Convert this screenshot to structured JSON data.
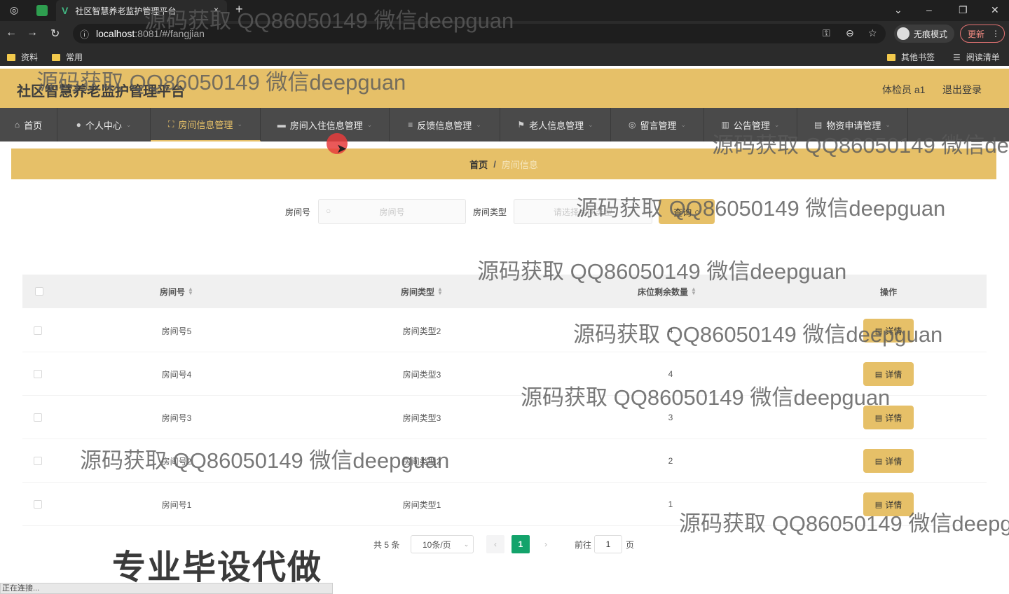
{
  "browser": {
    "tab_title": "社区智慧养老监护管理平台",
    "tab_close": "×",
    "new_tab": "+",
    "url_host": "localhost",
    "url_path": ":8081/#/fangjian",
    "incognito_label": "无痕模式",
    "update_label": "更新",
    "bookmarks": [
      "资料",
      "常用"
    ],
    "other_bookmarks": "其他书签",
    "reading_list": "阅读清单"
  },
  "header": {
    "title": "社区智慧养老监护管理平台",
    "user_role": "体检员 a1",
    "logout": "退出登录"
  },
  "menu": {
    "items": [
      {
        "label": "首页",
        "icon": "home-icon"
      },
      {
        "label": "个人中心",
        "icon": "user-icon"
      },
      {
        "label": "房间信息管理",
        "icon": "fullscreen-icon",
        "active": true
      },
      {
        "label": "房间入住信息管理",
        "icon": "monitor-icon"
      },
      {
        "label": "反馈信息管理",
        "icon": "list-icon"
      },
      {
        "label": "老人信息管理",
        "icon": "flag-icon"
      },
      {
        "label": "留言管理",
        "icon": "compass-icon"
      },
      {
        "label": "公告管理",
        "icon": "chart-icon"
      },
      {
        "label": "物资申请管理",
        "icon": "document-icon"
      }
    ]
  },
  "breadcrumb": {
    "home": "首页",
    "separator": "/",
    "current": "房间信息"
  },
  "search": {
    "room_no_label": "房间号",
    "room_no_placeholder": "房间号",
    "room_type_label": "房间类型",
    "room_type_placeholder": "请选择房间类型",
    "query_button": "查询"
  },
  "table": {
    "headers": {
      "room_no": "房间号",
      "room_type": "房间类型",
      "beds_left": "床位剩余数量",
      "action": "操作"
    },
    "rows": [
      {
        "room_no": "房间号5",
        "room_type": "房间类型2",
        "beds_left": "4",
        "action": "详情"
      },
      {
        "room_no": "房间号4",
        "room_type": "房间类型3",
        "beds_left": "4",
        "action": "详情"
      },
      {
        "room_no": "房间号3",
        "room_type": "房间类型3",
        "beds_left": "3",
        "action": "详情"
      },
      {
        "room_no": "房间号2",
        "room_type": "房间类型2",
        "beds_left": "2",
        "action": "详情"
      },
      {
        "room_no": "房间号1",
        "room_type": "房间类型1",
        "beds_left": "1",
        "action": "详情"
      }
    ]
  },
  "pagination": {
    "total": "共 5 条",
    "page_size": "10条/页",
    "current_page": "1",
    "goto_label": "前往",
    "goto_value": "1",
    "page_unit": "页"
  },
  "overlay": {
    "status": "正在连接...",
    "promo": "专业毕设代做",
    "watermark": "源码获取 QQ86050149 微信deepguan"
  },
  "colors": {
    "accent": "#e6c068",
    "menu_bg": "#4a4a4a",
    "pager_active": "#13a36b"
  }
}
